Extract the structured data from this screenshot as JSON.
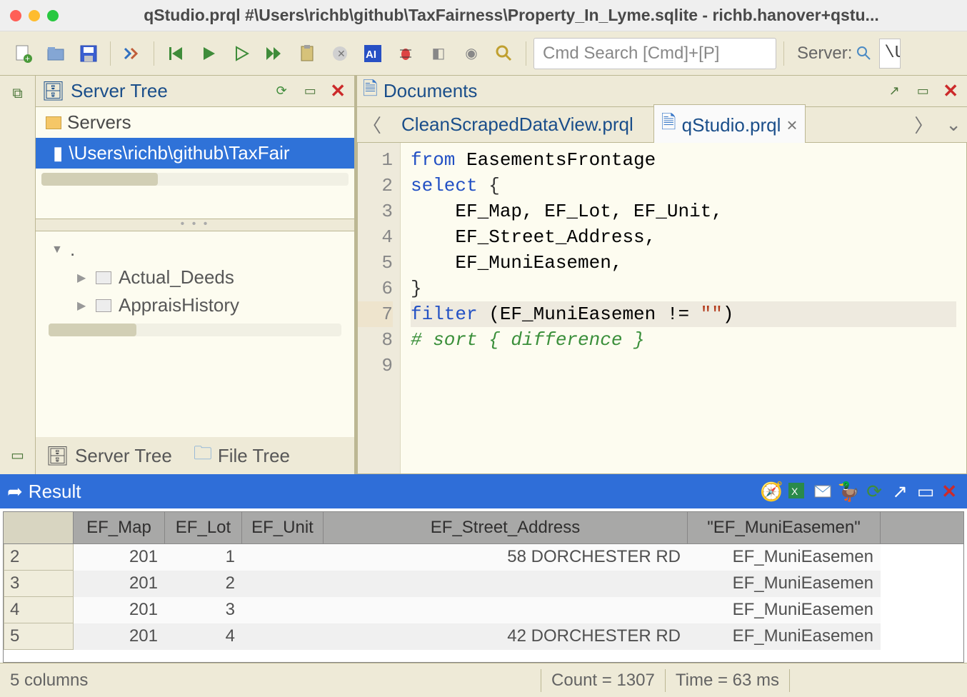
{
  "window": {
    "title": "qStudio.prql #\\Users\\richb\\github\\TaxFairness\\Property_In_Lyme.sqlite - richb.hanover+qstu..."
  },
  "toolbar": {
    "search_placeholder": "Cmd Search [Cmd]+[P]",
    "server_label": "Server:",
    "server_value": "\\U"
  },
  "serverTree": {
    "title": "Server Tree",
    "root": "Servers",
    "selectedNode": "\\Users\\richb\\github\\TaxFair",
    "subRoot": ".",
    "tables": [
      "Actual_Deeds",
      "AppraisHistory"
    ],
    "tabs": {
      "server": "Server Tree",
      "file": "File Tree"
    }
  },
  "documents": {
    "title": "Documents",
    "tabs": {
      "prev": "CleanScrapedDataView.prql",
      "active": "qStudio.prql"
    }
  },
  "editor": {
    "lines": [
      "1",
      "2",
      "3",
      "4",
      "5",
      "6",
      "7",
      "8",
      "9"
    ]
  },
  "code": {
    "l1_kw": "from ",
    "l1_rest": "EasementsFrontage",
    "l2_kw": "select ",
    "l2_b": "{",
    "l3": "    EF_Map, EF_Lot, EF_Unit,",
    "l4": "    EF_Street_Address,",
    "l5": "    EF_MuniEasemen,",
    "l6": "}",
    "l7_kw": "filter ",
    "l7_rest1": "(EF_MuniEasemen != ",
    "l7_str": "\"\"",
    "l7_rest2": ")",
    "l8": "# sort { difference }"
  },
  "result": {
    "title": "Result",
    "columns": [
      "EF_Map",
      "EF_Lot",
      "EF_Unit",
      "EF_Street_Address",
      "\"EF_MuniEasemen\""
    ],
    "rows": [
      {
        "n": "2",
        "map": "201",
        "lot": "1",
        "unit": "",
        "addr": "58 DORCHESTER RD",
        "muni": "EF_MuniEasemen"
      },
      {
        "n": "3",
        "map": "201",
        "lot": "2",
        "unit": "",
        "addr": "",
        "muni": "EF_MuniEasemen"
      },
      {
        "n": "4",
        "map": "201",
        "lot": "3",
        "unit": "",
        "addr": "",
        "muni": "EF_MuniEasemen"
      },
      {
        "n": "5",
        "map": "201",
        "lot": "4",
        "unit": "",
        "addr": "42 DORCHESTER RD",
        "muni": "EF_MuniEasemen"
      }
    ]
  },
  "status": {
    "columns": "5 columns",
    "count": "Count = 1307",
    "time": "Time = 63 ms"
  }
}
